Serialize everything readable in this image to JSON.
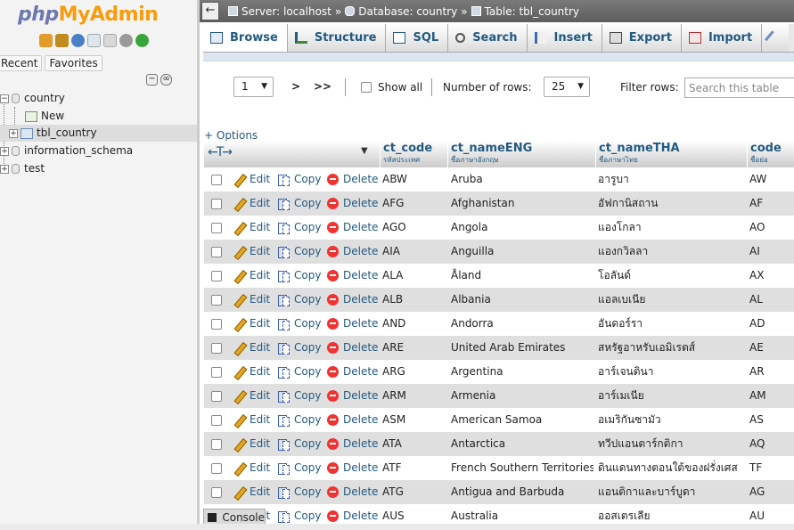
{
  "app": {
    "logo": {
      "php": "php",
      "my": "My",
      "admin": "Admin"
    }
  },
  "nav": {
    "tabs": [
      "Recent",
      "Favorites"
    ],
    "tree": [
      {
        "label": "country",
        "type": "database",
        "expanded": true
      },
      {
        "label": "New",
        "type": "new"
      },
      {
        "label": "tbl_country",
        "type": "table",
        "selected": true
      },
      {
        "label": "information_schema",
        "type": "database"
      },
      {
        "label": "test",
        "type": "database"
      }
    ]
  },
  "breadcrumb": {
    "server": "Server: localhost",
    "database": "Database: country",
    "table": "Table: tbl_country",
    "sep": "»"
  },
  "tabs": [
    {
      "label": "Browse",
      "icon": "browse-icon",
      "active": true
    },
    {
      "label": "Structure",
      "icon": "structure-icon"
    },
    {
      "label": "SQL",
      "icon": "sql-icon"
    },
    {
      "label": "Search",
      "icon": "search-icon"
    },
    {
      "label": "Insert",
      "icon": "insert-icon"
    },
    {
      "label": "Export",
      "icon": "export-icon"
    },
    {
      "label": "Import",
      "icon": "import-icon"
    }
  ],
  "controls": {
    "page": "1",
    "next": ">",
    "last": ">>",
    "show_all": "Show all",
    "rows_label": "Number of rows:",
    "rows_value": "25",
    "filter_label": "Filter rows:",
    "filter_placeholder": "Search this table",
    "options": "+ Options"
  },
  "table": {
    "columns": [
      {
        "name": "ct_code",
        "comment": "รหัสประเทศ"
      },
      {
        "name": "ct_nameENG",
        "comment": "ชื่อภาษาอังกฤษ"
      },
      {
        "name": "ct_nameTHA",
        "comment": "ชื่อภาษาไทย"
      },
      {
        "name": "code",
        "comment": "ชื่อย่อ"
      }
    ],
    "actions": {
      "edit": "Edit",
      "copy": "Copy",
      "delete": "Delete"
    },
    "rows": [
      [
        "ABW",
        "Aruba",
        "อารูบา",
        "AW"
      ],
      [
        "AFG",
        "Afghanistan",
        "อัฟกานิสถาน",
        "AF"
      ],
      [
        "AGO",
        "Angola",
        "แองโกลา",
        "AO"
      ],
      [
        "AIA",
        "Anguilla",
        "แองกวิลลา",
        "AI"
      ],
      [
        "ALA",
        "Åland",
        "โอลันด์",
        "AX"
      ],
      [
        "ALB",
        "Albania",
        "แอลเบเนีย",
        "AL"
      ],
      [
        "AND",
        "Andorra",
        "อันดอร์รา",
        "AD"
      ],
      [
        "ARE",
        "United Arab Emirates",
        "สหรัฐอาหรับเอมิเรตส์",
        "AE"
      ],
      [
        "ARG",
        "Argentina",
        "อาร์เจนตินา",
        "AR"
      ],
      [
        "ARM",
        "Armenia",
        "อาร์เมเนีย",
        "AM"
      ],
      [
        "ASM",
        "American Samoa",
        "อเมริกันซามัว",
        "AS"
      ],
      [
        "ATA",
        "Antarctica",
        "ทวีปแอนตาร์กติกา",
        "AQ"
      ],
      [
        "ATF",
        "French Southern Territories",
        "ดินแดนทางตอนใต้ของฝรั่งเศส",
        "TF"
      ],
      [
        "ATG",
        "Antigua and Barbuda",
        "แอนติกาและบาร์บูดา",
        "AG"
      ],
      [
        "AUS",
        "Australia",
        "ออสเตรเลีย",
        "AU"
      ]
    ]
  },
  "console": {
    "label": "Console"
  }
}
